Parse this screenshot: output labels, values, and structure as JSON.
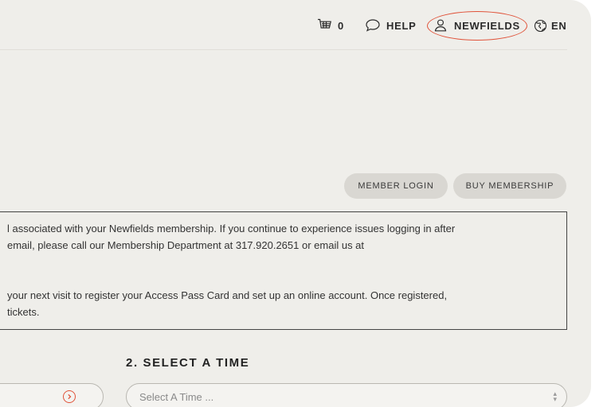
{
  "header": {
    "cart_count": "0",
    "help_label": "HELP",
    "account_label": "NEWFIELDS",
    "language_label": "EN"
  },
  "membership": {
    "login_label": "MEMBER LOGIN",
    "buy_label": "BUY MEMBERSHIP"
  },
  "notice": {
    "lines": [
      "l associated with your Newfields membership. If you continue to experience issues logging in after",
      " email, please call our Membership Department at 317.920.2651 or email us at",
      "",
      "",
      "your next visit to register your Access Pass Card and set up an online account. Once registered,",
      "tickets."
    ]
  },
  "time_section": {
    "title": "2. SELECT A TIME",
    "select_placeholder": "Select A Time ..."
  },
  "colors": {
    "background": "#efeeea",
    "highlight": "#e0533a",
    "pill": "#d9d7d2"
  },
  "icons": {
    "cart": "cart-icon",
    "help": "chat-bubble-icon",
    "account": "user-icon",
    "language": "globe-icon",
    "date": "chevron-right-circle-icon"
  }
}
